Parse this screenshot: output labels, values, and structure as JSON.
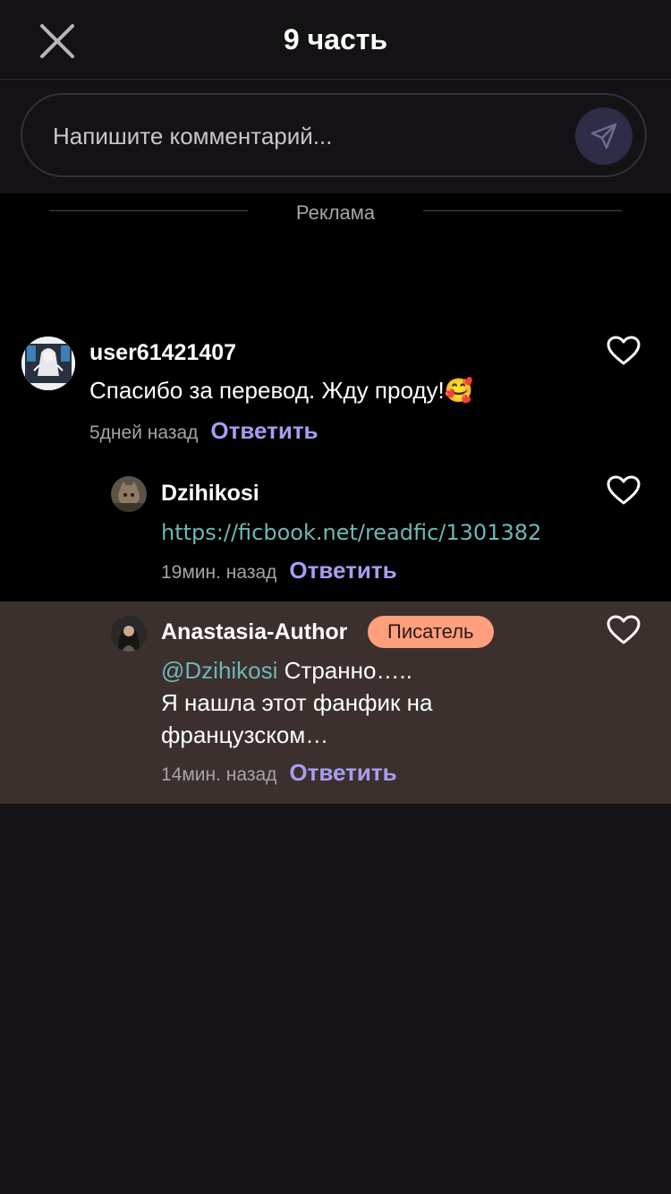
{
  "header": {
    "title": "9 часть"
  },
  "composer": {
    "placeholder": "Напишите комментарий..."
  },
  "ad": {
    "label": "Реклама"
  },
  "comments": [
    {
      "username": "user61421407",
      "text": "Спасибо за перевод. Жду проду!🥰",
      "time": "5дней назад",
      "reply_label": "Ответить"
    },
    {
      "username": "Dzihikosi",
      "link": "https://ficbook.net/readfic/1301382",
      "time": "19мин. назад",
      "reply_label": "Ответить"
    },
    {
      "username": "Anastasia-Author",
      "badge": "Писатель",
      "mention": "@Dzihikosi",
      "text_line1": " Странно…..",
      "text_line2": "Я нашла этот фанфик на",
      "text_line3": "французском…",
      "time": "14мин. назад",
      "reply_label": "Ответить"
    }
  ],
  "colors": {
    "background": "#141215",
    "accent_reply": "#a99cf0",
    "link": "#6fb7b7",
    "badge": "#ff9f7e",
    "highlight": "#3b302d"
  }
}
